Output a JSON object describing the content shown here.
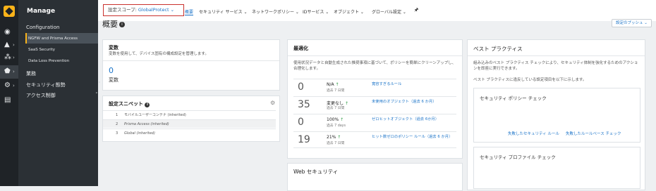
{
  "sidebar": {
    "title": "Manage",
    "configuration": "Configuration",
    "ngfw": "NGFW and Prisma Access",
    "saas": "SaaS Security",
    "dlp": "Data Loss Prevention",
    "ops": "業務",
    "sec_pos": "セキュリティ態勢",
    "access": "アクセス制御"
  },
  "topbar": {
    "scope_label": "設定スコープ: ",
    "scope_value": "GlobalProtect",
    "nav": [
      "概要",
      "セキュリティ サービス",
      "ネットワークポリシー",
      "IDサービス",
      "オブジェクト",
      "グローバル設定"
    ]
  },
  "page": {
    "title": "概要",
    "push_button": "設定のプッシュ"
  },
  "variables": {
    "title": "変数",
    "desc": "変数を使用して、デバイス固有の構成設定を管理します。",
    "count": "0",
    "count_label": "変数"
  },
  "snippets": {
    "title": "設定スニペット",
    "rows": [
      {
        "n": "1",
        "t": "モバイルユーザーコンテナ (inherited)"
      },
      {
        "n": "2",
        "t": "Prisma Access (inherited)"
      },
      {
        "n": "3",
        "t": "Global (inherited)"
      }
    ]
  },
  "optimization": {
    "title": "最適化",
    "desc": "使用状況データと自動生成された推奨事項に基づいて、ポリシーを簡単にクリーンアップし、合理化します。",
    "rows": [
      {
        "num": "0",
        "val": "N/A",
        "period": "過去 7 日間",
        "link": "寛容すぎるルール"
      },
      {
        "num": "35",
        "val": "変更なし",
        "period": "過去 7 日間",
        "link": "未使用のオブジェクト（過去 6 か月）"
      },
      {
        "num": "0",
        "val": "100%",
        "period": "過去 7 days",
        "link": "ゼロヒットオブジェクト（過去 6か月）"
      },
      {
        "num": "19",
        "val": "21%",
        "period": "過去 7 日間",
        "link": "ヒット数ゼロのポリシー ルール（過去 6 か月）"
      }
    ]
  },
  "web_security": {
    "title": "Web セキュリティ"
  },
  "best_practices": {
    "title": "ベスト プラクティス",
    "desc1": "組み込みのベスト プラクティス チェックにより、セキュリティ体制を強化するためのアクションを即座に実行できます。",
    "desc2": "ベスト プラクティスに違反している設定項目を以下に示します。",
    "policy_check": "セキュリティ ポリシー チェック",
    "failed_rules": "失敗したセキュリティ ルール",
    "failed_rulebase": "失敗したルールベース チェック",
    "profile_check": "セキュリティ プロファイル チェック"
  }
}
